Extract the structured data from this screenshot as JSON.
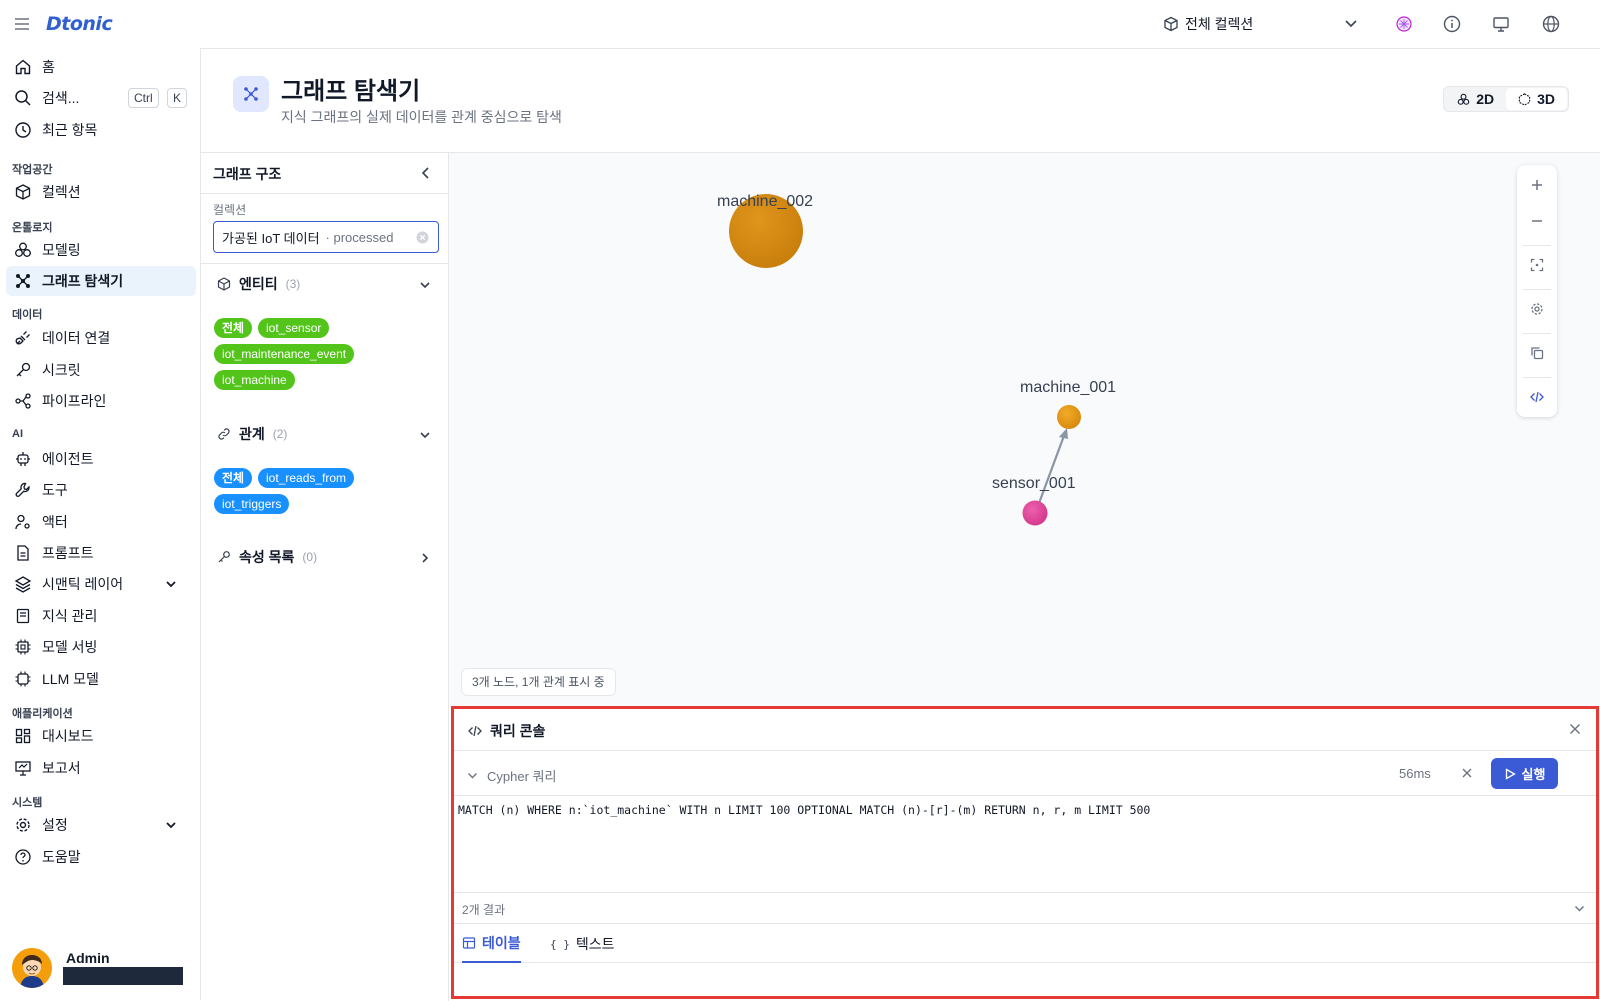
{
  "app": {
    "logo_text": "Dtonic"
  },
  "topbar": {
    "collection_selector": "전체 컬렉션"
  },
  "sidebar": {
    "home": "홈",
    "search": "검색...",
    "search_kbd_1": "Ctrl",
    "search_kbd_2": "K",
    "recent": "최근 항목",
    "section_workspace": "작업공간",
    "collections": "컬렉션",
    "section_ontology": "온톨로지",
    "modeling": "모델링",
    "graph_explorer": "그래프 탐색기",
    "section_data": "데이터",
    "data_connection": "데이터 연결",
    "secret": "시크릿",
    "pipeline": "파이프라인",
    "section_ai": "AI",
    "agent": "에이전트",
    "tool": "도구",
    "actor": "액터",
    "prompt": "프롬프트",
    "semantic_layer": "시맨틱 레이어",
    "knowledge": "지식 관리",
    "model_serving": "모델 서빙",
    "llm_model": "LLM 모델",
    "section_apps": "애플리케이션",
    "dashboard": "대시보드",
    "report": "보고서",
    "section_system": "시스템",
    "settings": "설정",
    "help": "도움말",
    "user_name": "Admin"
  },
  "header": {
    "title": "그래프 탐색기",
    "subtitle": "지식 그래프의 실제 데이터를 관계 중심으로 탐색",
    "btn_2d": "2D",
    "btn_3d": "3D"
  },
  "panel": {
    "title": "그래프 구조",
    "collection_label": "컬렉션",
    "collection_value": "가공된 IoT 데이터",
    "collection_tag": "· processed",
    "entities_label": "엔티티",
    "entities_count": "(3)",
    "entity_chips": [
      "전체",
      "iot_sensor",
      "iot_maintenance_event",
      "iot_machine"
    ],
    "relations_label": "관계",
    "relations_count": "(2)",
    "relation_chips": [
      "전체",
      "iot_reads_from",
      "iot_triggers"
    ],
    "props_label": "속성 목록",
    "props_count": "(0)"
  },
  "graph": {
    "nodes": [
      {
        "label": "machine_002",
        "color": "#d98c14"
      },
      {
        "label": "machine_001",
        "color": "#e69a12"
      },
      {
        "label": "sensor_001",
        "color": "#e0449a"
      }
    ],
    "status": "3개 노드, 1개 관계 표시 중"
  },
  "console": {
    "title": "쿼리 콘솔",
    "query_label": "Cypher 쿼리",
    "elapsed": "56ms",
    "run_label": "실행",
    "query": "MATCH (n) WHERE n:`iot_machine` WITH n LIMIT 100 OPTIONAL MATCH (n)-[r]-(m) RETURN n, r, m LIMIT 500",
    "result_count": "2개 결과",
    "tab_table": "테이블",
    "tab_text": "텍스트"
  },
  "colors": {
    "accent": "#3b5bd6",
    "entity_chip": "#52c41a",
    "relation_chip": "#1890ff",
    "highlight_border": "#e53935"
  }
}
